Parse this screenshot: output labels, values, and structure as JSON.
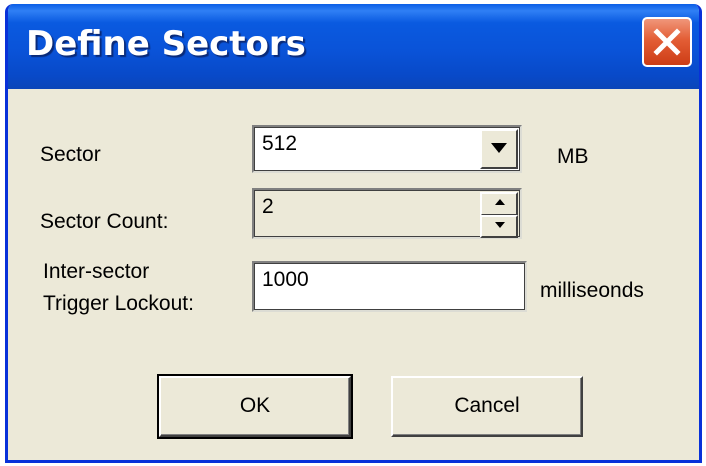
{
  "window": {
    "title": "Define Sectors",
    "close_label": "Close"
  },
  "form": {
    "sector": {
      "label": "Sector",
      "value": "512",
      "unit": "MB"
    },
    "sector_count": {
      "label": "Sector Count:",
      "value": "2"
    },
    "lockout": {
      "label_line1": "Inter-sector",
      "label_line2": "Trigger Lockout:",
      "value": "1000",
      "unit": "milliseonds"
    }
  },
  "buttons": {
    "ok_label": "OK",
    "cancel_label": "Cancel"
  },
  "colors": {
    "titlebar": "#0a53d8",
    "dialog_bg": "#ece9d8",
    "close_button": "#e35d35"
  }
}
